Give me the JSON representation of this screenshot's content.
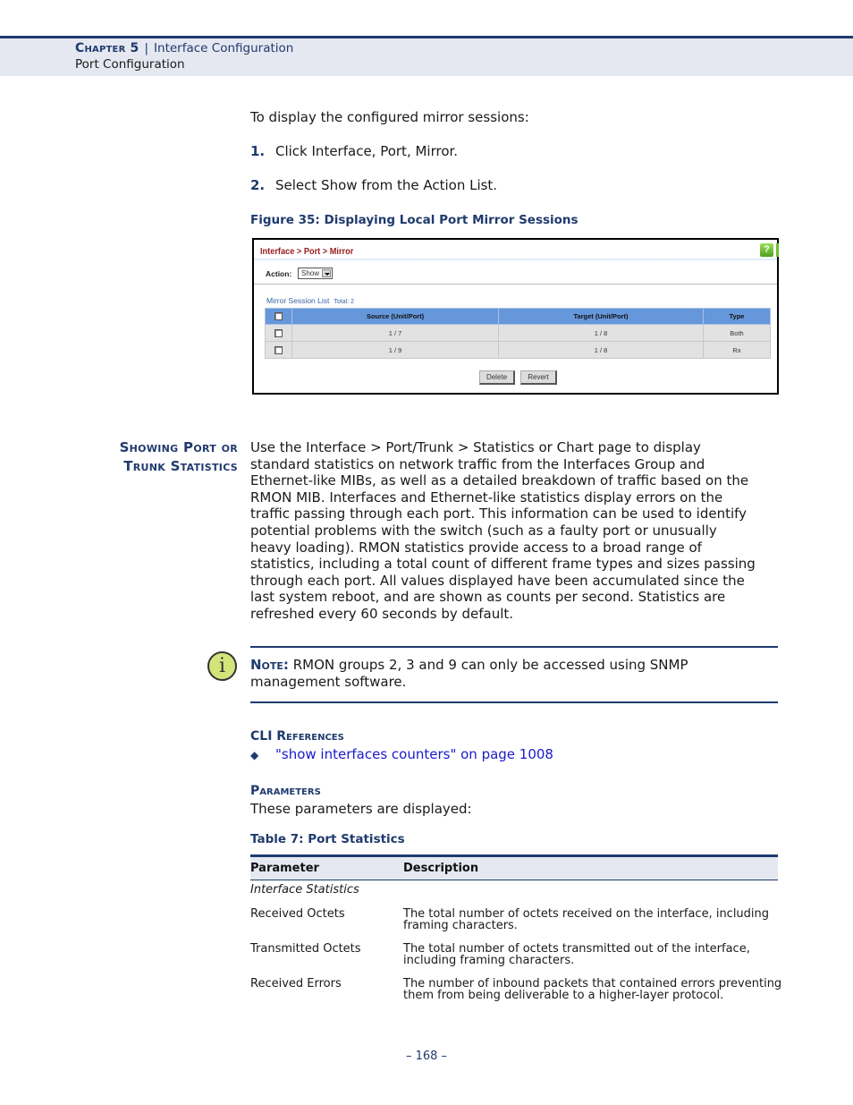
{
  "header": {
    "chapter": "Chapter 5",
    "separator": "|",
    "chapter_title": "Interface Configuration",
    "section": "Port Configuration"
  },
  "intro": {
    "lead": "To display the configured mirror sessions:",
    "steps": [
      {
        "num": "1.",
        "text": "Click Interface, Port, Mirror."
      },
      {
        "num": "2.",
        "text": "Select Show from the Action List."
      }
    ]
  },
  "figure": {
    "caption": "Figure 35:  Displaying Local Port Mirror Sessions",
    "breadcrumb": "Interface > Port > Mirror",
    "help_icon": "?",
    "action_label": "Action:",
    "action_value": "Show",
    "list_title": "Mirror Session List",
    "list_total": "Total: 2",
    "columns": [
      "Source (Unit/Port)",
      "Target (Unit/Port)",
      "Type"
    ],
    "rows": [
      {
        "source": "1 / 7",
        "target": "1 / 8",
        "type": "Both"
      },
      {
        "source": "1 / 9",
        "target": "1 / 8",
        "type": "Rx"
      }
    ],
    "buttons": {
      "delete": "Delete",
      "revert": "Revert"
    }
  },
  "section": {
    "heading_line1": "Showing Port or",
    "heading_line2": "Trunk Statistics",
    "paragraph_lines": [
      "Use the Interface > Port/Trunk > Statistics or Chart page to display",
      "standard statistics on network traffic from the Interfaces Group and",
      "Ethernet-like MIBs, as well as a detailed breakdown of traffic based on the",
      "RMON MIB. Interfaces and Ethernet-like statistics display errors on the",
      "traffic passing through each port. This information can be used to identify",
      "potential problems with the switch (such as a faulty port or unusually",
      "heavy loading). RMON statistics provide access to a broad range of",
      "statistics, including a total count of different frame types and sizes passing",
      "through each port. All values displayed have been accumulated since the",
      "last system reboot, and are shown as counts per second. Statistics are",
      "refreshed every 60 seconds by default."
    ]
  },
  "note": {
    "icon": "i",
    "label": "Note:",
    "line1": "RMON groups 2, 3 and 9 can only be accessed using SNMP",
    "line2": "management software."
  },
  "cli": {
    "heading": "CLI References",
    "bullet": "◆",
    "link": "\"show interfaces counters\" on page 1008"
  },
  "parameters": {
    "heading": "Parameters",
    "text": "These parameters are displayed:"
  },
  "table": {
    "caption": "Table 7: Port Statistics",
    "headers": [
      "Parameter",
      "Description"
    ],
    "group": "Interface Statistics",
    "rows": [
      {
        "param": "Received Octets",
        "desc1": "The total number of octets received on the interface, including",
        "desc2": "framing characters."
      },
      {
        "param": "Transmitted Octets",
        "desc1": "The total number of octets transmitted out of the interface,",
        "desc2": "including framing characters."
      },
      {
        "param": "Received Errors",
        "desc1": "The number of inbound packets that contained errors preventing",
        "desc2": "them from being deliverable to a higher-layer protocol."
      }
    ]
  },
  "footer": {
    "page": "–  168  –"
  }
}
